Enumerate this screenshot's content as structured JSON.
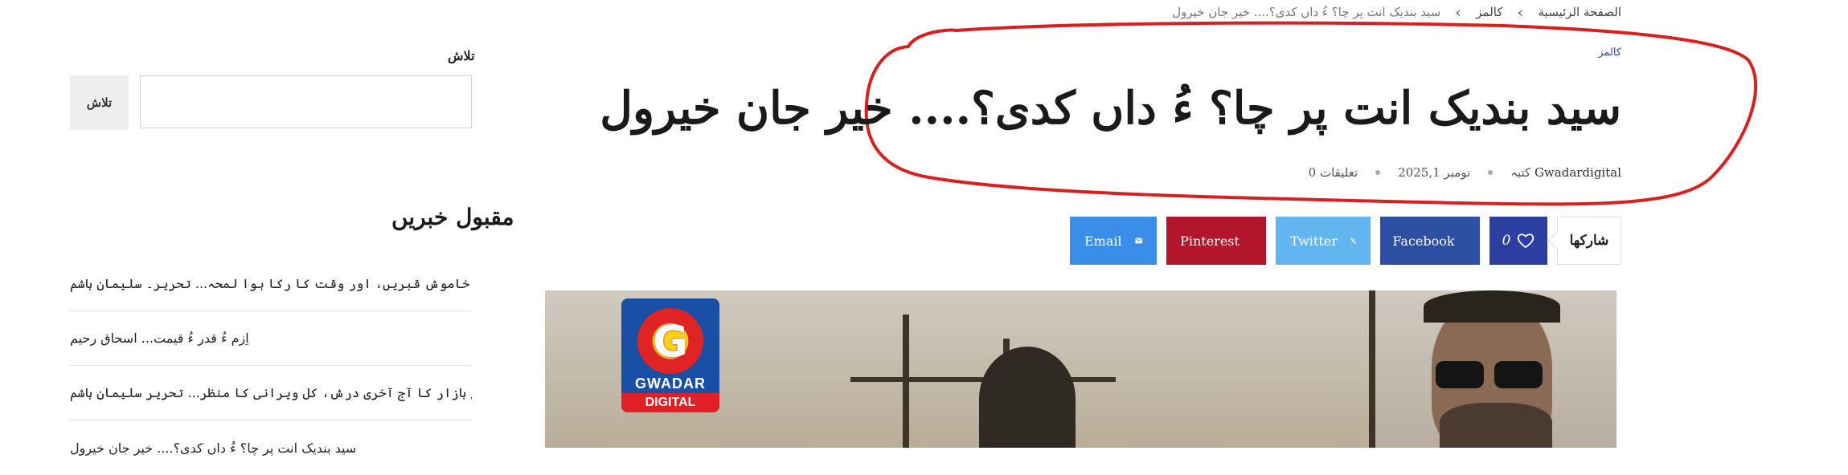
{
  "breadcrumb": {
    "home": "الصفحة الرئيسية",
    "category": "کالمز",
    "current": "سید بندیک انت پر چا؟ ءُ داں کدی؟.... خیر جان خیرول"
  },
  "article": {
    "category": "کالمز",
    "title": "سید بندیک انت پر چا؟ ءُ داں کدی؟.... خیر جان خیرول",
    "author_prefix": "کتبہ",
    "author": "Gwadardigital",
    "date": "نومبر 2025,1",
    "comments": "0 تعلیقات"
  },
  "share": {
    "label": "شارکھا",
    "like_count": "0",
    "facebook": "Facebook",
    "twitter": "Twitter",
    "pinterest": "Pinterest",
    "email": "Email"
  },
  "featured_image": {
    "logo_top": "GWADAR",
    "logo_bottom": "DIGITAL",
    "logo_letter": "G"
  },
  "sidebar": {
    "search_label": "تلاش",
    "search_button": "تلاش",
    "search_placeholder": "",
    "popular_title": "مقبول خبریں",
    "popular_items": [
      "کچا ایئرپورٹ، خاموش قبریں، اور وقت کا رکا ہوا لمحہ... تحریر۔ سلیمان ہاشم",
      "اِزم ءُ قدر ءُ قیمت... اسحاق رحیم",
      "گوادر کا موٹر سائیکل مکینکوں کے بازار کا آج آخری درش، کل ویرانی کا منظر... تحریر سلیمان ہاشم",
      "سید بندیک انت پر چا؟ ءُ داں کدی؟.... خیر جان خیرول"
    ]
  },
  "colors": {
    "highlight": "#d9201f",
    "facebook": "#2c4ea3",
    "twitter": "#63b5ef",
    "pinterest": "#b3152c",
    "email": "#3a8eea",
    "like": "#2c3ea0"
  }
}
